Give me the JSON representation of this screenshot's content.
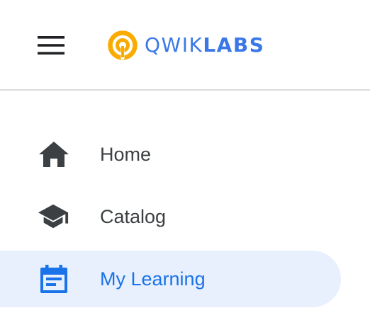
{
  "header": {
    "menu_icon": "hamburger-menu-icon",
    "logo": {
      "mark_icon": "qwiklabs-logo-mark",
      "text_light": "QWIK",
      "text_bold": "LABS",
      "brand_color": "#3b78e7",
      "mark_color": "#f9ab00"
    }
  },
  "nav": {
    "items": [
      {
        "label": "Home",
        "icon": "home-icon",
        "active": false
      },
      {
        "label": "Catalog",
        "icon": "graduation-cap-icon",
        "active": false
      },
      {
        "label": "My Learning",
        "icon": "calendar-list-icon",
        "active": true
      }
    ],
    "colors": {
      "text": "#3c4043",
      "icon": "#3c4043",
      "active_text": "#1a73e8",
      "active_bg": "#e8f0fe"
    }
  }
}
